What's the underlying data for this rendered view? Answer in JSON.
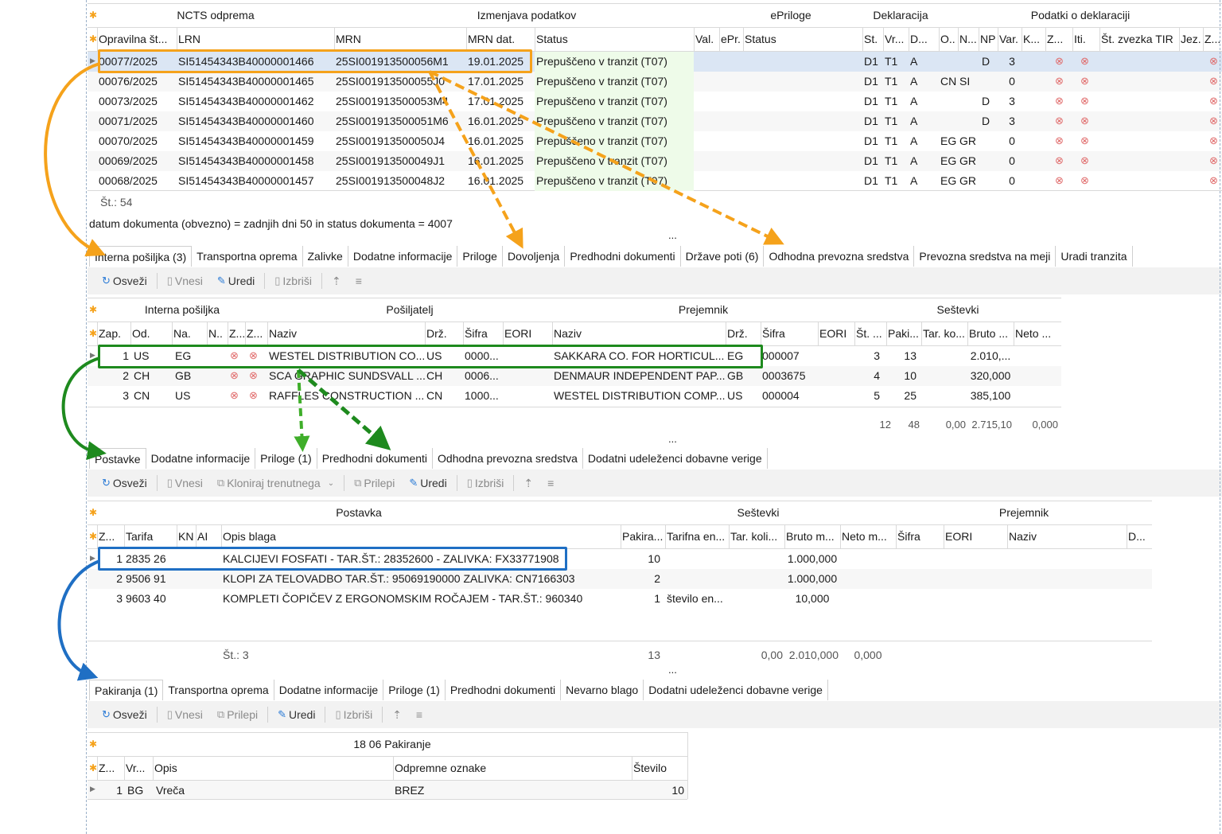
{
  "top": {
    "groups": [
      "NCTS odprema",
      "Izmenjava podatkov",
      "ePriloge",
      "Deklaracija",
      "Podatki o deklaraciji"
    ],
    "cols": [
      "Opravilna št...",
      "LRN",
      "MRN",
      "MRN dat.",
      "Status",
      "Val.",
      "ePr.",
      "Status",
      "St.",
      "Vr...",
      "D...",
      "O..",
      "N...",
      "NP",
      "Var.",
      "K...",
      "Z...",
      "Iti.",
      "Št. zvezka TIR",
      "Jez.",
      "Z..."
    ],
    "rows": [
      {
        "opr": "00077/2025",
        "lrn": "SI51454343B40000001466",
        "mrn": "25SI001913500056M1",
        "dat": "19.01.2025",
        "status": "Prepuščeno v tranzit (T07)",
        "st": "D1",
        "vr": "T1",
        "d": "A",
        "o": "",
        "n": "",
        "np": "D",
        "var": "3"
      },
      {
        "opr": "00076/2025",
        "lrn": "SI51454343B40000001465",
        "mrn": "25SI001913500055J0",
        "dat": "17.01.2025",
        "status": "Prepuščeno v tranzit (T07)",
        "st": "D1",
        "vr": "T1",
        "d": "A",
        "o": "CN",
        "n": "SI",
        "np": "",
        "var": "0"
      },
      {
        "opr": "00073/2025",
        "lrn": "SI51454343B40000001462",
        "mrn": "25SI001913500053M4",
        "dat": "17.01.2025",
        "status": "Prepuščeno v tranzit (T07)",
        "st": "D1",
        "vr": "T1",
        "d": "A",
        "o": "",
        "n": "",
        "np": "D",
        "var": "3"
      },
      {
        "opr": "00071/2025",
        "lrn": "SI51454343B40000001460",
        "mrn": "25SI001913500051M6",
        "dat": "16.01.2025",
        "status": "Prepuščeno v tranzit (T07)",
        "st": "D1",
        "vr": "T1",
        "d": "A",
        "o": "",
        "n": "",
        "np": "D",
        "var": "3"
      },
      {
        "opr": "00070/2025",
        "lrn": "SI51454343B40000001459",
        "mrn": "25SI001913500050J4",
        "dat": "16.01.2025",
        "status": "Prepuščeno v tranzit (T07)",
        "st": "D1",
        "vr": "T1",
        "d": "A",
        "o": "EG",
        "n": "GR",
        "np": "",
        "var": "0"
      },
      {
        "opr": "00069/2025",
        "lrn": "SI51454343B40000001458",
        "mrn": "25SI001913500049J1",
        "dat": "16.01.2025",
        "status": "Prepuščeno v tranzit (T07)",
        "st": "D1",
        "vr": "T1",
        "d": "A",
        "o": "EG",
        "n": "GR",
        "np": "",
        "var": "0"
      },
      {
        "opr": "00068/2025",
        "lrn": "SI51454343B40000001457",
        "mrn": "25SI001913500048J2",
        "dat": "16.01.2025",
        "status": "Prepuščeno v tranzit (T07)",
        "st": "D1",
        "vr": "T1",
        "d": "A",
        "o": "EG",
        "n": "GR",
        "np": "",
        "var": "0"
      }
    ],
    "count": "Št.: 54",
    "filter": "datum dokumenta (obvezno) = zadnjih dni 50 in status dokumenta = 4007"
  },
  "ellipsis": "...",
  "x_glyph": "⊗",
  "tabs1": [
    "Interna pošiljka (3)",
    "Transportna oprema",
    "Zalivke",
    "Dodatne informacije",
    "Priloge",
    "Dovoljenja",
    "Predhodni dokumenti",
    "Države poti (6)",
    "Odhodna prevozna sredstva",
    "Prevozna sredstva na meji",
    "Uradi tranzita"
  ],
  "toolbar1": [
    "Osveži",
    "Vnesi",
    "Uredi",
    "Izbriši"
  ],
  "ship": {
    "groups": [
      "Interna pošiljka",
      "Pošiljatelj",
      "Prejemnik",
      "Seštevki"
    ],
    "cols": [
      "Zap.",
      "Od.",
      "Na.",
      "N..",
      "Z...",
      "Z...",
      "Naziv",
      "Drž.",
      "Šifra",
      "EORI",
      "Naziv",
      "Drž.",
      "Šifra",
      "EORI",
      "Št. ...",
      "Paki...",
      "Tar. ko...",
      "Bruto ...",
      "Neto ..."
    ],
    "rows": [
      {
        "zap": "1",
        "od": "US",
        "na": "EG",
        "pn": "WESTEL DISTRIBUTION CO...",
        "pd": "US",
        "ps": "0000...",
        "rn": "SAKKARA CO. FOR HORTICUL...",
        "rd": "EG",
        "rs": "000007",
        "st": "3",
        "pak": "13",
        "bru": "2.010,..."
      },
      {
        "zap": "2",
        "od": "CH",
        "na": "GB",
        "pn": "SCA GRAPHIC SUNDSVALL ...",
        "pd": "CH",
        "ps": "0006...",
        "rn": "DENMAUR INDEPENDENT PAP...",
        "rd": "GB",
        "rs": "0003675",
        "st": "4",
        "pak": "10",
        "bru": "320,000"
      },
      {
        "zap": "3",
        "od": "CN",
        "na": "US",
        "pn": "RAFFLES CONSTRUCTION ...",
        "pd": "CN",
        "ps": "1000...",
        "rn": "WESTEL DISTRIBUTION COMP...",
        "rd": "US",
        "rs": "000004",
        "st": "5",
        "pak": "25",
        "bru": "385,100"
      }
    ],
    "totals": {
      "st": "12",
      "pak": "48",
      "tar": "0,00",
      "bru": "2.715,10",
      "neto": "0,000"
    }
  },
  "tabs2": [
    "Postavke",
    "Dodatne informacije",
    "Priloge (1)",
    "Predhodni dokumenti",
    "Odhodna prevozna sredstva",
    "Dodatni udeleženci dobavne verige"
  ],
  "toolbar2": [
    "Osveži",
    "Vnesi",
    "Kloniraj trenutnega",
    "Prilepi",
    "Uredi",
    "Izbriši"
  ],
  "items": {
    "groups": [
      "Postavka",
      "Seštevki",
      "Prejemnik"
    ],
    "cols": [
      "Z...",
      "Tarifa",
      "KN",
      "AI",
      "Opis blaga",
      "Pakira...",
      "Tarifna en...",
      "Tar. koli...",
      "Bruto m...",
      "Neto m...",
      "Šifra",
      "EORI",
      "Naziv",
      "D..."
    ],
    "rows": [
      {
        "z": "1",
        "tar": "2835 26",
        "opis": "KALCIJEVI FOSFATI - TAR.ŠT.: 28352600 - ZALIVKA: FX33771908",
        "pak": "10",
        "ten": "",
        "bru": "1.000,000"
      },
      {
        "z": "2",
        "tar": "9506 91",
        "opis": "KLOPI ZA TELOVADBO TAR.ŠT.: 95069190000 ZALIVKA: CN7166303",
        "pak": "2",
        "ten": "",
        "bru": "1.000,000"
      },
      {
        "z": "3",
        "tar": "9603 40",
        "opis": "KOMPLETI ČOPIČEV Z ERGONOMSKIM ROČAJEM - TAR.ŠT.: 960340",
        "pak": "1",
        "ten": "število en...",
        "bru": "10,000"
      }
    ],
    "count": "Št.: 3",
    "totals": {
      "pak": "13",
      "tar": "0,00",
      "bru": "2.010,000",
      "neto": "0,000"
    }
  },
  "tabs3": [
    "Pakiranja (1)",
    "Transportna oprema",
    "Dodatne informacije",
    "Priloge (1)",
    "Predhodni dokumenti",
    "Nevarno blago",
    "Dodatni udeleženci dobavne verige"
  ],
  "toolbar3": [
    "Osveži",
    "Vnesi",
    "Prilepi",
    "Uredi",
    "Izbriši"
  ],
  "pack": {
    "group": "18 06 Pakiranje",
    "cols": [
      "Z...",
      "Vr...",
      "Opis",
      "Odpremne oznake",
      "Število"
    ],
    "rows": [
      {
        "z": "1",
        "vr": "BG",
        "opis": "Vreča",
        "oznake": "BREZ",
        "stevilo": "10"
      }
    ]
  },
  "colors": {
    "orange": "#f5a21b",
    "green": "#1e8a1e",
    "blue": "#1f6fc4",
    "selected": "#dbe6f4",
    "status_bg": "#eefbe9"
  }
}
